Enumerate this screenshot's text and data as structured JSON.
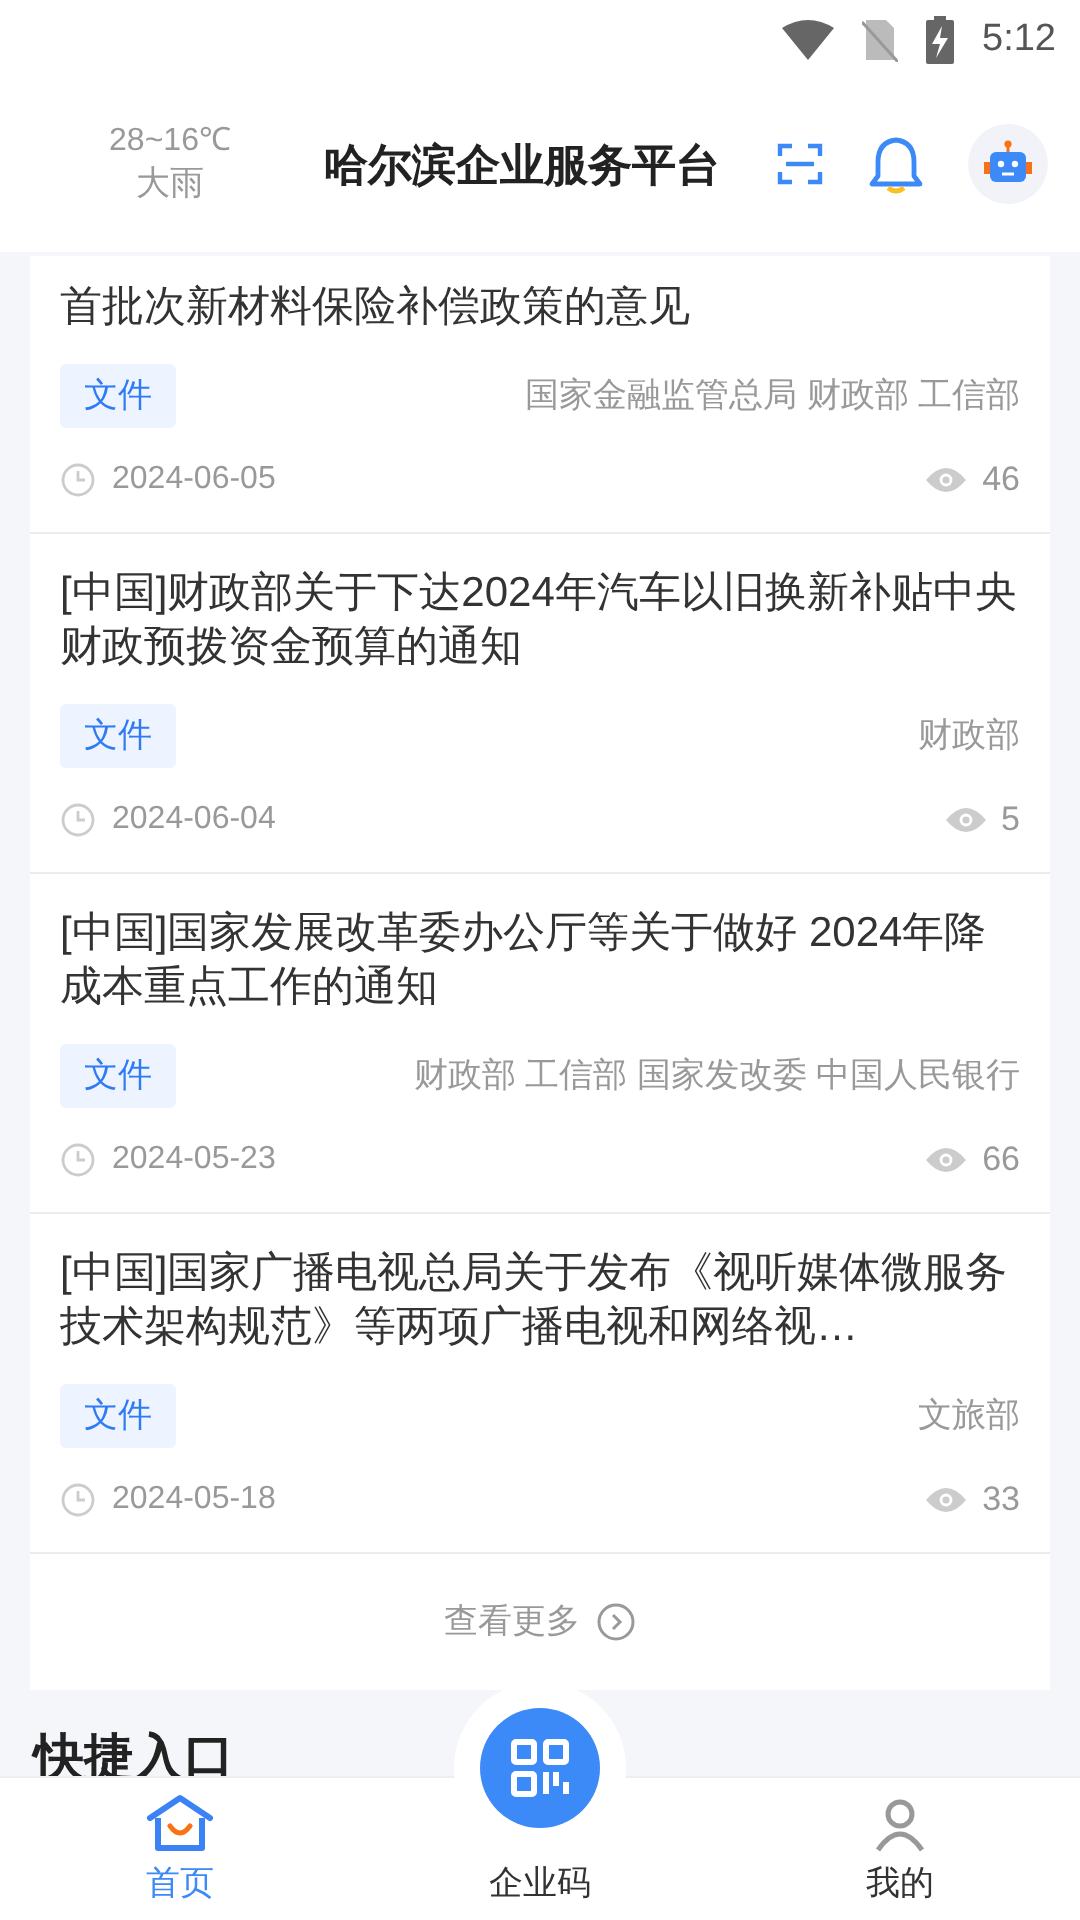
{
  "status_bar": {
    "time": "5:12"
  },
  "header": {
    "weather": {
      "temperature": "28~16℃",
      "condition": "大雨"
    },
    "title": "哈尔滨企业服务平台"
  },
  "news": [
    {
      "title": "首批次新材料保险补偿政策的意见",
      "tag": "文件",
      "source": "国家金融监管总局 财政部 工信部",
      "date": "2024-06-05",
      "views": "46"
    },
    {
      "title": "[中国]财政部关于下达2024年汽车以旧换新补贴中央财政预拨资金预算的通知",
      "tag": "文件",
      "source": "财政部",
      "date": "2024-06-04",
      "views": "5"
    },
    {
      "title": "[中国]国家发展改革委办公厅等关于做好 2024年降成本重点工作的通知",
      "tag": "文件",
      "source": "财政部 工信部 国家发改委 中国人民银行",
      "date": "2024-05-23",
      "views": "66"
    },
    {
      "title": "[中国]国家广播电视总局关于发布《视听媒体微服务技术架构规范》等两项广播电视和网络视…",
      "tag": "文件",
      "source": "文旅部",
      "date": "2024-05-18",
      "views": "33"
    }
  ],
  "more_link": "查看更多",
  "section_title": "快捷入口",
  "tab_bar": [
    {
      "kind": "home",
      "label": "首页",
      "selected": true
    },
    {
      "kind": "code",
      "label": "企业码",
      "selected": false
    },
    {
      "kind": "user",
      "label": "我的",
      "selected": false
    }
  ]
}
